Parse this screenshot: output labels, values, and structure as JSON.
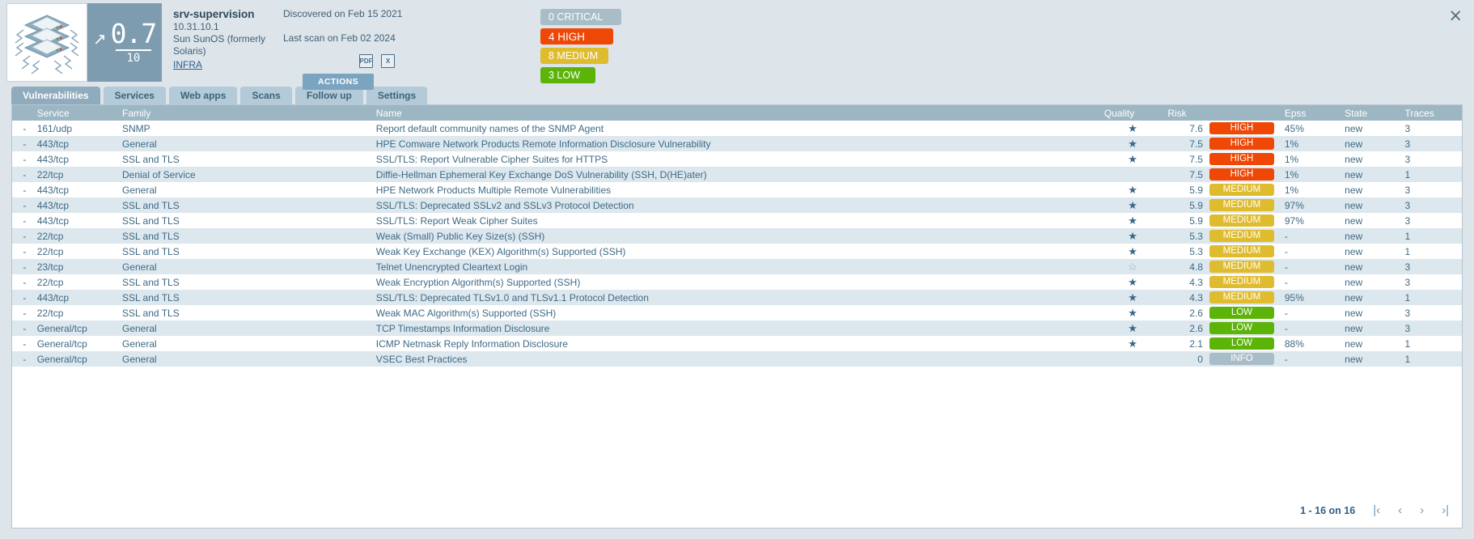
{
  "asset": {
    "name": "srv-supervision",
    "ip": "10.31.10.1",
    "os": "Sun SunOS (formerly Solaris)",
    "tag": "INFRA",
    "score": "0.7",
    "score_denominator": "10",
    "trend_icon": "arrow-up-right-icon",
    "thumbnail_icon": "server-stack-icon"
  },
  "scan": {
    "discovered": "Discovered on Feb 15 2021",
    "last_scan": "Last scan on Feb 02 2024",
    "export_pdf_label": "PDF",
    "export_xlsx_label": "X",
    "actions_label": "ACTIONS"
  },
  "severity_summary": [
    {
      "label": "0 CRITICAL",
      "color": "#a9bdc8",
      "class": "sev-critical"
    },
    {
      "label": "4 HIGH",
      "color": "#ef4806",
      "class": "sev-high"
    },
    {
      "label": "8 MEDIUM",
      "color": "#dfbb2e",
      "class": "sev-medium"
    },
    {
      "label": "3 LOW",
      "color": "#5cb408",
      "class": "sev-low"
    }
  ],
  "window": {
    "close_label": "×"
  },
  "tabs": [
    {
      "label": "Vulnerabilities",
      "active": true
    },
    {
      "label": "Services",
      "active": false
    },
    {
      "label": "Web apps",
      "active": false
    },
    {
      "label": "Scans",
      "active": false
    },
    {
      "label": "Follow up",
      "active": false
    },
    {
      "label": "Settings",
      "active": false
    }
  ],
  "table": {
    "columns": [
      {
        "key": "expand",
        "label": "",
        "cls": "col-exp"
      },
      {
        "key": "service",
        "label": "Service",
        "cls": "col-svc"
      },
      {
        "key": "family",
        "label": "Family",
        "cls": "col-fam"
      },
      {
        "key": "name",
        "label": "Name",
        "cls": "col-name"
      },
      {
        "key": "quality",
        "label": "Quality",
        "cls": "col-qual"
      },
      {
        "key": "risk",
        "label": "Risk",
        "cls": "col-risk"
      },
      {
        "key": "sev",
        "label": "",
        "cls": "col-sev"
      },
      {
        "key": "epss",
        "label": "Epss",
        "cls": "col-epss"
      },
      {
        "key": "state",
        "label": "State",
        "cls": "col-state"
      },
      {
        "key": "traces",
        "label": "Traces",
        "cls": "col-traces"
      }
    ],
    "rows": [
      {
        "expand": "-",
        "service": "161/udp",
        "family": "SNMP",
        "name": "Report default community names of the SNMP Agent",
        "quality": "full",
        "risk": "7.6",
        "sev": "HIGH",
        "epss": "45%",
        "state": "new",
        "traces": "3"
      },
      {
        "expand": "-",
        "service": "443/tcp",
        "family": "General",
        "name": "HPE Comware Network Products Remote Information Disclosure Vulnerability",
        "quality": "full",
        "risk": "7.5",
        "sev": "HIGH",
        "epss": "1%",
        "state": "new",
        "traces": "3"
      },
      {
        "expand": "-",
        "service": "443/tcp",
        "family": "SSL and TLS",
        "name": "SSL/TLS: Report Vulnerable Cipher Suites for HTTPS",
        "quality": "full",
        "risk": "7.5",
        "sev": "HIGH",
        "epss": "1%",
        "state": "new",
        "traces": "3"
      },
      {
        "expand": "-",
        "service": "22/tcp",
        "family": "Denial of Service",
        "name": "Diffie-Hellman Ephemeral Key Exchange DoS Vulnerability (SSH, D(HE)ater)",
        "quality": "none",
        "risk": "7.5",
        "sev": "HIGH",
        "epss": "1%",
        "state": "new",
        "traces": "1"
      },
      {
        "expand": "-",
        "service": "443/tcp",
        "family": "General",
        "name": "HPE Network Products Multiple Remote Vulnerabilities",
        "quality": "full",
        "risk": "5.9",
        "sev": "MEDIUM",
        "epss": "1%",
        "state": "new",
        "traces": "3"
      },
      {
        "expand": "-",
        "service": "443/tcp",
        "family": "SSL and TLS",
        "name": "SSL/TLS: Deprecated SSLv2 and SSLv3 Protocol Detection",
        "quality": "full",
        "risk": "5.9",
        "sev": "MEDIUM",
        "epss": "97%",
        "state": "new",
        "traces": "3"
      },
      {
        "expand": "-",
        "service": "443/tcp",
        "family": "SSL and TLS",
        "name": "SSL/TLS: Report Weak Cipher Suites",
        "quality": "full",
        "risk": "5.9",
        "sev": "MEDIUM",
        "epss": "97%",
        "state": "new",
        "traces": "3"
      },
      {
        "expand": "-",
        "service": "22/tcp",
        "family": "SSL and TLS",
        "name": "Weak (Small) Public Key Size(s) (SSH)",
        "quality": "full",
        "risk": "5.3",
        "sev": "MEDIUM",
        "epss": "-",
        "state": "new",
        "traces": "1"
      },
      {
        "expand": "-",
        "service": "22/tcp",
        "family": "SSL and TLS",
        "name": "Weak Key Exchange (KEX) Algorithm(s) Supported (SSH)",
        "quality": "full",
        "risk": "5.3",
        "sev": "MEDIUM",
        "epss": "-",
        "state": "new",
        "traces": "1"
      },
      {
        "expand": "-",
        "service": "23/tcp",
        "family": "General",
        "name": "Telnet Unencrypted Cleartext Login",
        "quality": "empty",
        "risk": "4.8",
        "sev": "MEDIUM",
        "epss": "-",
        "state": "new",
        "traces": "3"
      },
      {
        "expand": "-",
        "service": "22/tcp",
        "family": "SSL and TLS",
        "name": "Weak Encryption Algorithm(s) Supported (SSH)",
        "quality": "full",
        "risk": "4.3",
        "sev": "MEDIUM",
        "epss": "-",
        "state": "new",
        "traces": "3"
      },
      {
        "expand": "-",
        "service": "443/tcp",
        "family": "SSL and TLS",
        "name": "SSL/TLS: Deprecated TLSv1.0 and TLSv1.1 Protocol Detection",
        "quality": "full",
        "risk": "4.3",
        "sev": "MEDIUM",
        "epss": "95%",
        "state": "new",
        "traces": "1"
      },
      {
        "expand": "-",
        "service": "22/tcp",
        "family": "SSL and TLS",
        "name": "Weak MAC Algorithm(s) Supported (SSH)",
        "quality": "full",
        "risk": "2.6",
        "sev": "LOW",
        "epss": "-",
        "state": "new",
        "traces": "3"
      },
      {
        "expand": "-",
        "service": "General/tcp",
        "family": "General",
        "name": "TCP Timestamps Information Disclosure",
        "quality": "full",
        "risk": "2.6",
        "sev": "LOW",
        "epss": "-",
        "state": "new",
        "traces": "3"
      },
      {
        "expand": "-",
        "service": "General/tcp",
        "family": "General",
        "name": "ICMP Netmask Reply Information Disclosure",
        "quality": "full",
        "risk": "2.1",
        "sev": "LOW",
        "epss": "88%",
        "state": "new",
        "traces": "1"
      },
      {
        "expand": "-",
        "service": "General/tcp",
        "family": "General",
        "name": "VSEC Best Practices",
        "quality": "none",
        "risk": "0",
        "sev": "INFO",
        "epss": "-",
        "state": "new",
        "traces": "1"
      }
    ]
  },
  "pagination": {
    "range_text": "1 - 16 on 16",
    "first_label": "|‹",
    "prev_label": "‹",
    "next_label": "›",
    "last_label": "›|"
  }
}
